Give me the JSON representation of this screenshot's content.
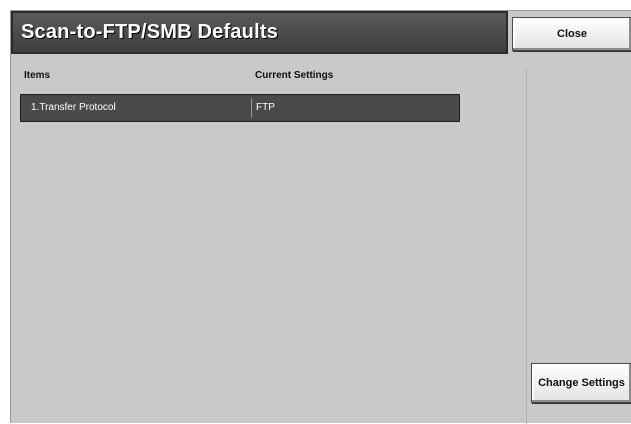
{
  "header": {
    "title": "Scan-to-FTP/SMB Defaults",
    "close_label": "Close"
  },
  "table": {
    "columns": [
      "Items",
      "Current Settings"
    ],
    "rows": [
      {
        "item": "1.Transfer Protocol",
        "value": "FTP"
      }
    ]
  },
  "actions": {
    "change_settings_label": "Change Settings"
  },
  "colors": {
    "title_bar": "#4a4a4a",
    "screen_bg": "#c9c9c9",
    "selected_row": "#4a4a4a"
  }
}
